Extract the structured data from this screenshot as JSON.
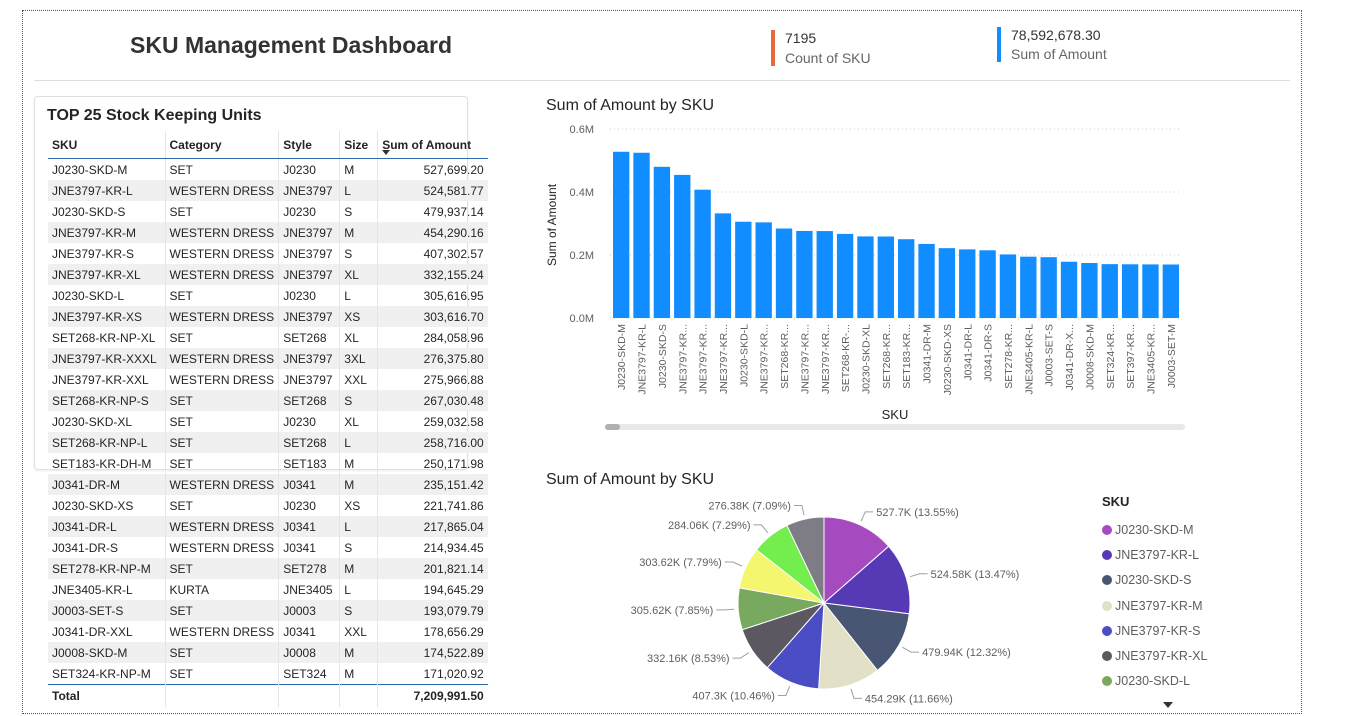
{
  "header": {
    "title": "SKU Management Dashboard",
    "kpis": [
      {
        "value": "7195",
        "label": "Count of SKU",
        "color": "#E66C37"
      },
      {
        "value": "78,592,678.30",
        "label": "Sum of Amount",
        "color": "#118DFF"
      }
    ]
  },
  "table": {
    "title": "TOP 25 Stock Keeping Units",
    "columns": [
      "SKU",
      "Category",
      "Style",
      "Size",
      "Sum of Amount"
    ],
    "rows": [
      [
        "J0230-SKD-M",
        "SET",
        "J0230",
        "M",
        "527,699.20"
      ],
      [
        "JNE3797-KR-L",
        "WESTERN DRESS",
        "JNE3797",
        "L",
        "524,581.77"
      ],
      [
        "J0230-SKD-S",
        "SET",
        "J0230",
        "S",
        "479,937.14"
      ],
      [
        "JNE3797-KR-M",
        "WESTERN DRESS",
        "JNE3797",
        "M",
        "454,290.16"
      ],
      [
        "JNE3797-KR-S",
        "WESTERN DRESS",
        "JNE3797",
        "S",
        "407,302.57"
      ],
      [
        "JNE3797-KR-XL",
        "WESTERN DRESS",
        "JNE3797",
        "XL",
        "332,155.24"
      ],
      [
        "J0230-SKD-L",
        "SET",
        "J0230",
        "L",
        "305,616.95"
      ],
      [
        "JNE3797-KR-XS",
        "WESTERN DRESS",
        "JNE3797",
        "XS",
        "303,616.70"
      ],
      [
        "SET268-KR-NP-XL",
        "SET",
        "SET268",
        "XL",
        "284,058.96"
      ],
      [
        "JNE3797-KR-XXXL",
        "WESTERN DRESS",
        "JNE3797",
        "3XL",
        "276,375.80"
      ],
      [
        "JNE3797-KR-XXL",
        "WESTERN DRESS",
        "JNE3797",
        "XXL",
        "275,966.88"
      ],
      [
        "SET268-KR-NP-S",
        "SET",
        "SET268",
        "S",
        "267,030.48"
      ],
      [
        "J0230-SKD-XL",
        "SET",
        "J0230",
        "XL",
        "259,032.58"
      ],
      [
        "SET268-KR-NP-L",
        "SET",
        "SET268",
        "L",
        "258,716.00"
      ],
      [
        "SET183-KR-DH-M",
        "SET",
        "SET183",
        "M",
        "250,171.98"
      ],
      [
        "J0341-DR-M",
        "WESTERN DRESS",
        "J0341",
        "M",
        "235,151.42"
      ],
      [
        "J0230-SKD-XS",
        "SET",
        "J0230",
        "XS",
        "221,741.86"
      ],
      [
        "J0341-DR-L",
        "WESTERN DRESS",
        "J0341",
        "L",
        "217,865.04"
      ],
      [
        "J0341-DR-S",
        "WESTERN DRESS",
        "J0341",
        "S",
        "214,934.45"
      ],
      [
        "SET278-KR-NP-M",
        "SET",
        "SET278",
        "M",
        "201,821.14"
      ],
      [
        "JNE3405-KR-L",
        "KURTA",
        "JNE3405",
        "L",
        "194,645.29"
      ],
      [
        "J0003-SET-S",
        "SET",
        "J0003",
        "S",
        "193,079.79"
      ],
      [
        "J0341-DR-XXL",
        "WESTERN DRESS",
        "J0341",
        "XXL",
        "178,656.29"
      ],
      [
        "J0008-SKD-M",
        "SET",
        "J0008",
        "M",
        "174,522.89"
      ],
      [
        "SET324-KR-NP-M",
        "SET",
        "SET324",
        "M",
        "171,020.92"
      ]
    ],
    "total_label": "Total",
    "total_value": "7,209,991.50"
  },
  "chart_data": [
    {
      "type": "bar",
      "title": "Sum of Amount by SKU",
      "xlabel": "SKU",
      "ylabel": "Sum of Amount",
      "ylim": [
        0,
        600000
      ],
      "yticks": [
        "0.0M",
        "0.2M",
        "0.4M",
        "0.6M"
      ],
      "color": "#118DFF",
      "categories": [
        "J0230-SKD-M",
        "JNE3797-KR-L",
        "J0230-SKD-S",
        "JNE3797-KR...",
        "JNE3797-KR...",
        "JNE3797-KR...",
        "J0230-SKD-L",
        "JNE3797-KR...",
        "SET268-KR...",
        "JNE3797-KR...",
        "JNE3797-KR...",
        "SET268-KR-...",
        "J0230-SKD-XL",
        "SET268-KR...",
        "SET183-KR...",
        "J0341-DR-M",
        "J0230-SKD-XS",
        "J0341-DR-L",
        "J0341-DR-S",
        "SET278-KR...",
        "JNE3405-KR-L",
        "J0003-SET-S",
        "J0341-DR-X...",
        "J0008-SKD-M",
        "SET324-KR...",
        "SET397-KR...",
        "JNE3405-KR...",
        "J0003-SET-M"
      ],
      "values": [
        527699,
        524582,
        479937,
        454290,
        407303,
        332155,
        305617,
        303617,
        284059,
        276376,
        275967,
        267030,
        259033,
        258716,
        250172,
        235151,
        221742,
        217865,
        214934,
        201821,
        194645,
        193080,
        178656,
        174523,
        171021,
        170500,
        170100,
        169800
      ]
    },
    {
      "type": "pie",
      "title": "Sum of Amount by SKU",
      "legend_title": "SKU",
      "legend": [
        "J0230-SKD-M",
        "JNE3797-KR-L",
        "J0230-SKD-S",
        "JNE3797-KR-M",
        "JNE3797-KR-S",
        "JNE3797-KR-XL",
        "J0230-SKD-L"
      ],
      "slices": [
        {
          "value": 527.7,
          "label": "527.7K (13.55%)",
          "color": "#A64BBF"
        },
        {
          "value": 524.58,
          "label": "524.58K (13.47%)",
          "color": "#5539B5"
        },
        {
          "value": 479.94,
          "label": "479.94K (12.32%)",
          "color": "#485673"
        },
        {
          "value": 454.29,
          "label": "454.29K (11.66%)",
          "color": "#E2E0C6"
        },
        {
          "value": 407.3,
          "label": "407.3K (10.46%)",
          "color": "#4A4DC4"
        },
        {
          "value": 332.16,
          "label": "332.16K (8.53%)",
          "color": "#5C5862"
        },
        {
          "value": 305.62,
          "label": "305.62K (7.85%)",
          "color": "#79A95F"
        },
        {
          "value": 303.62,
          "label": "303.62K (7.79%)",
          "color": "#F4F66E"
        },
        {
          "value": 284.06,
          "label": "284.06K (7.29%)",
          "color": "#73EE4E"
        },
        {
          "value": 276.38,
          "label": "276.38K (7.09%)",
          "color": "#7E7D86"
        }
      ]
    }
  ]
}
